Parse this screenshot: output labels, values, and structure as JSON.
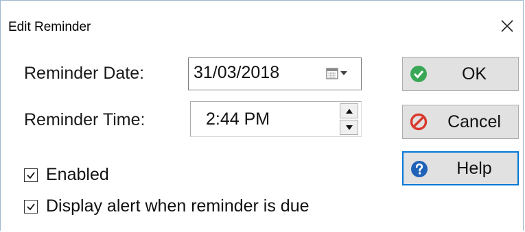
{
  "window": {
    "title": "Edit Reminder"
  },
  "form": {
    "date_label": "Reminder Date:",
    "date_value": "31/03/2018",
    "time_label": "Reminder Time:",
    "time_value": "2:44 PM"
  },
  "options": {
    "enabled_label": "Enabled",
    "enabled_checked": true,
    "alert_label": "Display alert when reminder is due",
    "alert_checked": true
  },
  "buttons": {
    "ok_label": "OK",
    "cancel_label": "Cancel",
    "help_label": "Help"
  },
  "icons": {
    "ok": "checkmark-circle-icon",
    "cancel": "no-entry-icon",
    "help": "question-circle-icon",
    "close": "close-icon",
    "calendar": "calendar-dropdown-icon"
  },
  "colors": {
    "ok_icon": "#3aa757",
    "cancel_icon": "#d9382c",
    "help_icon": "#1f62b8",
    "default_button_border": "#0078d7",
    "button_face": "#e1e1e1"
  }
}
